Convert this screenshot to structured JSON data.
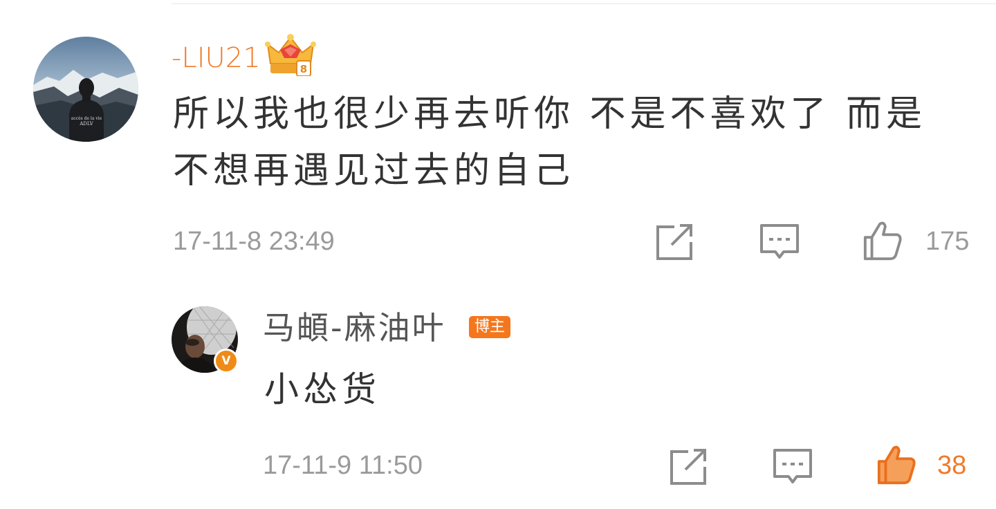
{
  "comment": {
    "username": "-LIU21",
    "text": "所以我也很少再去听你 不是不喜欢了 而是不想再遇见过去的自己",
    "timestamp": "17-11-8 23:49",
    "like_count": "175",
    "avatar_shirt_text_line1": "accès de la vie",
    "avatar_shirt_text_line2": "ADLV",
    "badge_icon": "crown-badge-icon",
    "username_color": "#f07a29"
  },
  "reply": {
    "username": "马頔-麻油叶",
    "author_badge": "博主",
    "verified_mark": "V",
    "text": "小怂货",
    "timestamp": "17-11-9 11:50",
    "like_count": "38",
    "liked": true,
    "liked_color": "#f07a29"
  },
  "icons": {
    "share": "share-icon",
    "comment": "comment-icon",
    "like": "thumbs-up-icon"
  }
}
